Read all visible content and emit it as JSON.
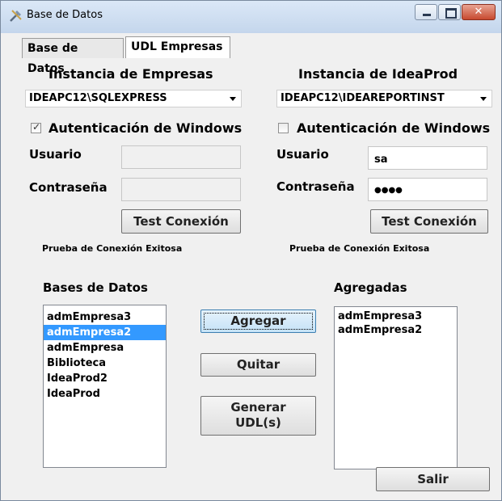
{
  "window": {
    "title": "Base de Datos"
  },
  "tabs": [
    {
      "label": "Base de Datos"
    },
    {
      "label": "UDL Empresas"
    }
  ],
  "empresas": {
    "header": "Instancia de Empresas",
    "instance_value": "IDEAPC12\\SQLEXPRESS",
    "auth_label": "Autenticación de Windows",
    "auth_checked": true,
    "user_label": "Usuario",
    "user_value": "",
    "password_label": "Contraseña",
    "password_value": "",
    "test_button": "Test Conexión",
    "status": "Prueba de Conexión Exitosa"
  },
  "ideaprod": {
    "header": "Instancia de IdeaProd",
    "instance_value": "IDEAPC12\\IDEAREPORTINST",
    "auth_label": "Autenticación de Windows",
    "auth_checked": false,
    "user_label": "Usuario",
    "user_value": "sa",
    "password_label": "Contraseña",
    "password_value": "●●●●",
    "test_button": "Test Conexión",
    "status": "Prueba de Conexión Exitosa"
  },
  "databases": {
    "label": "Bases de  Datos",
    "items": [
      {
        "label": "admEmpresa3",
        "selected": false
      },
      {
        "label": "admEmpresa2",
        "selected": true
      },
      {
        "label": "admEmpresa",
        "selected": false
      },
      {
        "label": "Biblioteca",
        "selected": false
      },
      {
        "label": "IdeaProd2",
        "selected": false
      },
      {
        "label": "IdeaProd",
        "selected": false
      }
    ]
  },
  "added": {
    "label": "Agregadas",
    "items": [
      "admEmpresa3",
      "admEmpresa2"
    ]
  },
  "actions": {
    "add": "Agregar",
    "remove": "Quitar",
    "generate_line1": "Generar",
    "generate_line2": "UDL(s)",
    "exit": "Salir"
  },
  "colors": {
    "selection": "#3399ff"
  }
}
